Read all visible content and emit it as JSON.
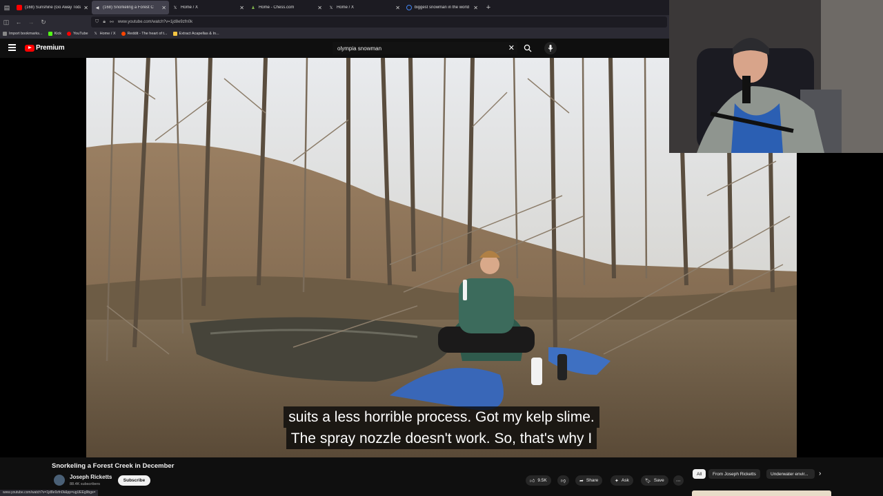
{
  "browser": {
    "tabs": [
      {
        "title": "(168) Sunshine (Go Away Today)",
        "color": "#ff0000",
        "active": false
      },
      {
        "title": "(168) Snorkeling a Forest C",
        "color": "#ff0000",
        "active": true
      },
      {
        "title": "Home / X",
        "color": "#ffffff",
        "active": false
      },
      {
        "title": "Home - Chess.com",
        "color": "#81b64c",
        "active": false
      },
      {
        "title": "Home / X",
        "color": "#ffffff",
        "active": false
      },
      {
        "title": "biggest snowman in the world",
        "color": "#4285f4",
        "active": false
      }
    ],
    "url": "www.youtube.com/watch?v=1jd8e9zfn0k",
    "bookmarks": [
      {
        "label": "Import bookmarks...",
        "color": "#888888"
      },
      {
        "label": "Kick",
        "color": "#53fc18"
      },
      {
        "label": "YouTube",
        "color": "#ff0000"
      },
      {
        "label": "Home / X",
        "color": "#ffffff"
      },
      {
        "label": "Reddit - The heart of t...",
        "color": "#ff4500"
      },
      {
        "label": "Extract Acapellas & In...",
        "color": "#f5c542"
      }
    ],
    "status_url": "www.youtube.com/watch?v=1jd8e9zfn0k&pp=ugUEEg9bgs="
  },
  "youtube": {
    "logo_text": "Premium",
    "search_value": "olympia snowman",
    "caption_lines": [
      "suits a less horrible process. Got my kelp slime.",
      "The spray nozzle doesn't work. So, that's why I"
    ],
    "video_title": "Snorkeling a Forest Creek in December",
    "channel_name": "Joseph Ricketts",
    "subscribers": "88.4K subscribers",
    "subscribe_label": "Subscribe",
    "like_count": "9.5K",
    "share_label": "Share",
    "ask_label": "Ask",
    "save_label": "Save",
    "chips": [
      "All",
      "From Joseph Ricketts",
      "Underwater envir..."
    ]
  }
}
